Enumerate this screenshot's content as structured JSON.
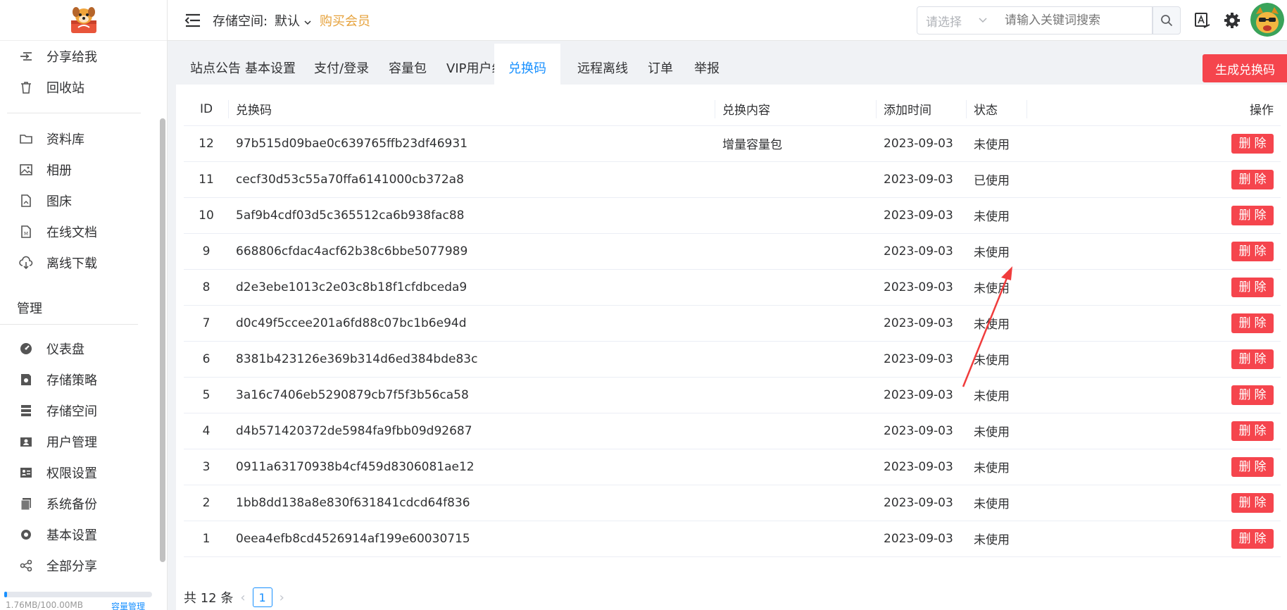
{
  "sidebar": {
    "top_items": [
      {
        "label": "分享给我",
        "icon": "share-in-icon"
      },
      {
        "label": "回收站",
        "icon": "trash-icon"
      }
    ],
    "library_items": [
      {
        "label": "资料库",
        "icon": "folder-icon"
      },
      {
        "label": "相册",
        "icon": "image-icon"
      },
      {
        "label": "图床",
        "icon": "file-image-icon"
      },
      {
        "label": "在线文档",
        "icon": "document-icon"
      },
      {
        "label": "离线下载",
        "icon": "cloud-download-icon"
      }
    ],
    "admin_group": "管理",
    "admin_items": [
      {
        "label": "仪表盘",
        "icon": "dashboard-icon"
      },
      {
        "label": "存储策略",
        "icon": "storage-policy-icon"
      },
      {
        "label": "存储空间",
        "icon": "server-icon"
      },
      {
        "label": "用户管理",
        "icon": "user-manage-icon"
      },
      {
        "label": "权限设置",
        "icon": "permission-icon"
      },
      {
        "label": "系统备份",
        "icon": "backup-icon"
      },
      {
        "label": "基本设置",
        "icon": "gear-icon"
      },
      {
        "label": "全部分享",
        "icon": "share-icon"
      }
    ],
    "storage": {
      "used_text": "1.76MB/100.00MB",
      "manage_link": "容量管理",
      "used_fraction": 0.018
    }
  },
  "header": {
    "space_label": "存储空间:",
    "space_value": "默认",
    "vip_link": "会员",
    "vip_prefix": "购买",
    "select_placeholder": "请选择",
    "search_placeholder": "请输入关键词搜索"
  },
  "tabs": [
    {
      "label": "站点公告",
      "active": false
    },
    {
      "label": "基本设置",
      "active": false
    },
    {
      "label": "支付/登录",
      "active": false
    },
    {
      "label": "容量包",
      "active": false
    },
    {
      "label": "VIP用户组",
      "active": false
    },
    {
      "label": "兑换码",
      "active": true
    },
    {
      "label": "远程离线",
      "active": false
    },
    {
      "label": "订单",
      "active": false
    },
    {
      "label": "举报",
      "active": false
    }
  ],
  "generate_button": "生成兑换码",
  "table": {
    "columns": [
      "ID",
      "兑换码",
      "兑换内容",
      "添加时间",
      "状态",
      "操作"
    ],
    "delete_label": "删除",
    "rows": [
      {
        "id": "12",
        "code": "97b515d09bae0c639765ffb23df46931",
        "content": "增量容量包",
        "date": "2023-09-03",
        "status": "未使用"
      },
      {
        "id": "11",
        "code": "cecf30d53c55a70ffa6141000cb372a8",
        "content": "",
        "date": "2023-09-03",
        "status": "已使用"
      },
      {
        "id": "10",
        "code": "5af9b4cdf03d5c365512ca6b938fac88",
        "content": "",
        "date": "2023-09-03",
        "status": "未使用"
      },
      {
        "id": "9",
        "code": "668806cfdac4acf62b38c6bbe5077989",
        "content": "",
        "date": "2023-09-03",
        "status": "未使用"
      },
      {
        "id": "8",
        "code": "d2e3ebe1013c2e03c8b18f1cfdbceda9",
        "content": "",
        "date": "2023-09-03",
        "status": "未使用"
      },
      {
        "id": "7",
        "code": "d0c49f5ccee201a6fd88c07bc1b6e94d",
        "content": "",
        "date": "2023-09-03",
        "status": "未使用"
      },
      {
        "id": "6",
        "code": "8381b423126e369b314d6ed384bde83c",
        "content": "",
        "date": "2023-09-03",
        "status": "未使用"
      },
      {
        "id": "5",
        "code": "3a16c7406eb5290879cb7f5f3b56ca58",
        "content": "",
        "date": "2023-09-03",
        "status": "未使用"
      },
      {
        "id": "4",
        "code": "d4b571420372de5984fa9fbb09d92687",
        "content": "",
        "date": "2023-09-03",
        "status": "未使用"
      },
      {
        "id": "3",
        "code": "0911a63170938b4cf459d8306081ae12",
        "content": "",
        "date": "2023-09-03",
        "status": "未使用"
      },
      {
        "id": "2",
        "code": "1bb8dd138a8e830f631841cdcd64f836",
        "content": "",
        "date": "2023-09-03",
        "status": "未使用"
      },
      {
        "id": "1",
        "code": "0eea4efb8cd4526914af199e60030715",
        "content": "",
        "date": "2023-09-03",
        "status": "未使用"
      }
    ]
  },
  "pager": {
    "total_text": "共 12 条",
    "current_page": "1"
  }
}
